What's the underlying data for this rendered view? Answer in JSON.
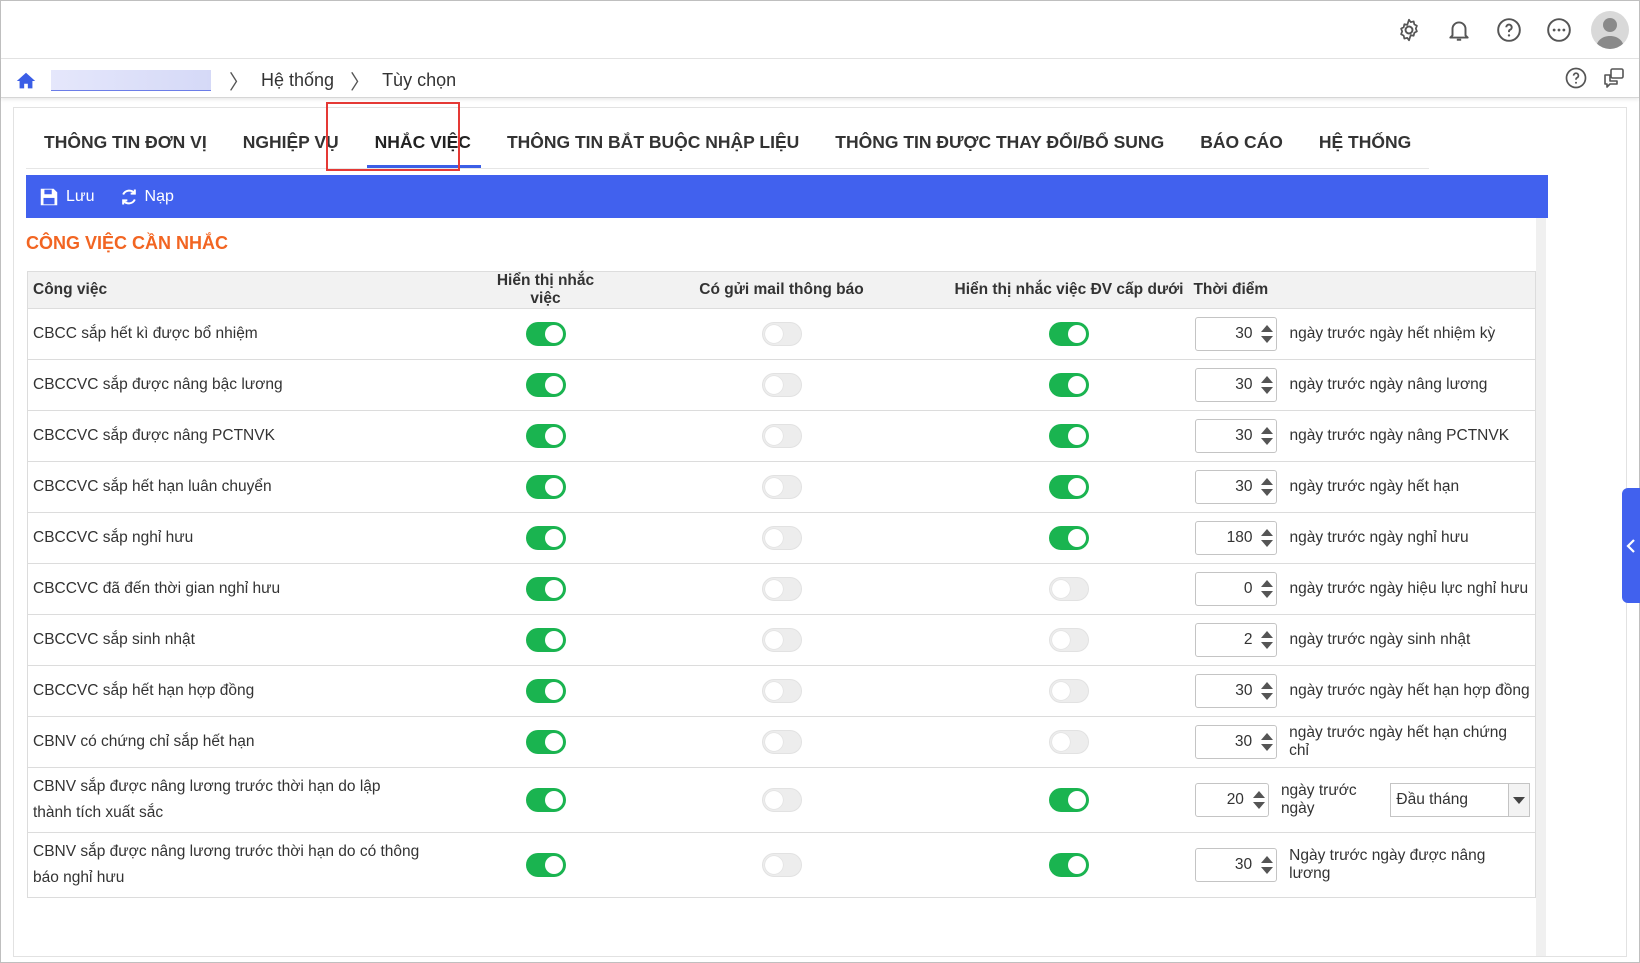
{
  "header": {
    "icons": [
      "gear-icon",
      "bell-icon",
      "help-icon",
      "more-icon",
      "avatar"
    ]
  },
  "breadcrumb": {
    "items": [
      "Hệ thống",
      "Tùy chọn"
    ]
  },
  "tabs": [
    {
      "label": "THÔNG TIN ĐƠN VỊ"
    },
    {
      "label": "NGHIỆP VỤ"
    },
    {
      "label": "NHẮC VIỆC",
      "active": true
    },
    {
      "label": "THÔNG TIN BẮT BUỘC NHẬP LIỆU"
    },
    {
      "label": "THÔNG TIN ĐƯỢC THAY ĐỔI/BỔ SUNG"
    },
    {
      "label": "BÁO CÁO"
    },
    {
      "label": "HỆ THỐNG"
    }
  ],
  "toolbar": {
    "save_label": "Lưu",
    "reload_label": "Nạp"
  },
  "section": {
    "title": "CÔNG VIỆC CẦN NHẮC"
  },
  "table": {
    "headers": {
      "task": "Công việc",
      "show": "Hiển thị nhắc việc",
      "mail": "Có gửi mail thông báo",
      "sub": "Hiển thị nhắc việc ĐV cấp dưới",
      "time": "Thời điểm"
    },
    "rows": [
      {
        "task": "CBCC sắp hết kì được bổ nhiệm",
        "show": true,
        "mail": false,
        "sub": true,
        "value": "30",
        "unit": "ngày trước ngày hết nhiệm kỳ"
      },
      {
        "task": "CBCCVC sắp được nâng bậc lương",
        "show": true,
        "mail": false,
        "sub": true,
        "value": "30",
        "unit": "ngày trước ngày nâng lương"
      },
      {
        "task": "CBCCVC sắp được nâng PCTNVK",
        "show": true,
        "mail": false,
        "sub": true,
        "value": "30",
        "unit": "ngày trước ngày nâng PCTNVK"
      },
      {
        "task": "CBCCVC sắp hết hạn luân chuyển",
        "show": true,
        "mail": false,
        "sub": true,
        "value": "30",
        "unit": "ngày trước ngày hết hạn"
      },
      {
        "task": "CBCCVC sắp nghỉ hưu",
        "show": true,
        "mail": false,
        "sub": true,
        "value": "180",
        "unit": "ngày trước ngày nghỉ hưu"
      },
      {
        "task": "CBCCVC đã đến thời gian nghỉ hưu",
        "show": true,
        "mail": false,
        "sub": false,
        "value": "0",
        "unit": "ngày trước ngày hiệu lực nghỉ hưu"
      },
      {
        "task": "CBCCVC sắp sinh nhật",
        "show": true,
        "mail": false,
        "sub": false,
        "value": "2",
        "unit": "ngày trước ngày sinh nhật"
      },
      {
        "task": "CBCCVC sắp hết hạn hợp đồng",
        "show": true,
        "mail": false,
        "sub": false,
        "value": "30",
        "unit": "ngày trước ngày hết hạn hợp đồng"
      },
      {
        "task": "CBNV có chứng chỉ sắp hết hạn",
        "show": true,
        "mail": false,
        "sub": false,
        "value": "30",
        "unit": "ngày trước ngày hết hạn chứng chỉ"
      },
      {
        "task": "CBNV sắp được nâng lương trước thời hạn do lập thành tích xuất sắc",
        "show": true,
        "mail": false,
        "sub": true,
        "value": "20",
        "unit": "ngày trước ngày",
        "select": "Đầu tháng"
      },
      {
        "task": "CBNV sắp được nâng lương trước thời hạn do có thông báo nghỉ hưu",
        "show": true,
        "mail": false,
        "sub": true,
        "value": "30",
        "unit": "Ngày trước ngày được nâng lương"
      }
    ]
  },
  "colors": {
    "accent": "#4161ee",
    "toggle_on": "#1ab450",
    "section_title": "#f26522",
    "highlight": "#e53935"
  }
}
